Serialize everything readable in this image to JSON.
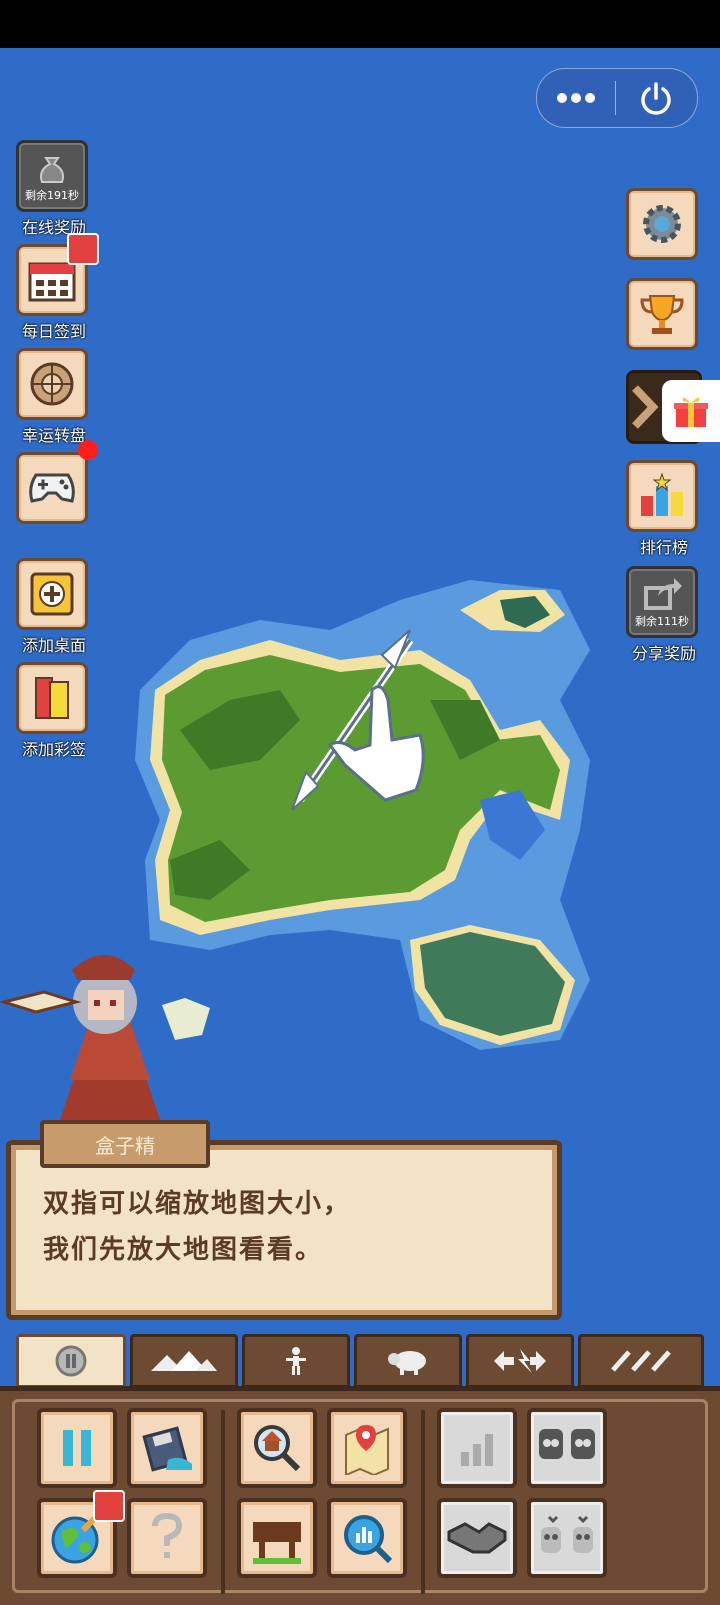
{
  "side_left": [
    {
      "label": "在线奖励",
      "timer": "剩余191秒",
      "icon": "money-bag-icon"
    },
    {
      "label": "每日签到",
      "icon": "calendar-icon"
    },
    {
      "label": "幸运转盘",
      "icon": "wheel-icon"
    },
    {
      "label": "",
      "icon": "gamepad-icon"
    },
    {
      "label": "添加桌面",
      "icon": "add-icon"
    },
    {
      "label": "添加彩签",
      "icon": "bookmark-icon"
    }
  ],
  "side_right": [
    {
      "label": "",
      "icon": "gear-icon"
    },
    {
      "label": "",
      "icon": "trophy-icon"
    },
    {
      "label": "",
      "icon": "collapse-arrow-icon"
    },
    {
      "label": "排行榜",
      "icon": "leaderboard-icon"
    },
    {
      "label": "分享奖励",
      "timer": "剩余111秒",
      "icon": "share-icon"
    }
  ],
  "dialog": {
    "speaker": "盒子精",
    "line1": "双指可以缩放地图大小，",
    "line2": "我们先放大地图看看。"
  },
  "tabs": [
    "pause-tab",
    "terrain-tab",
    "creatures-tab",
    "animals-tab",
    "powers-tab",
    "tools-tab"
  ],
  "colors": {
    "ocean": "#2f6cc8",
    "wood": "#6d4b33",
    "parchment": "#f2e2c6"
  }
}
